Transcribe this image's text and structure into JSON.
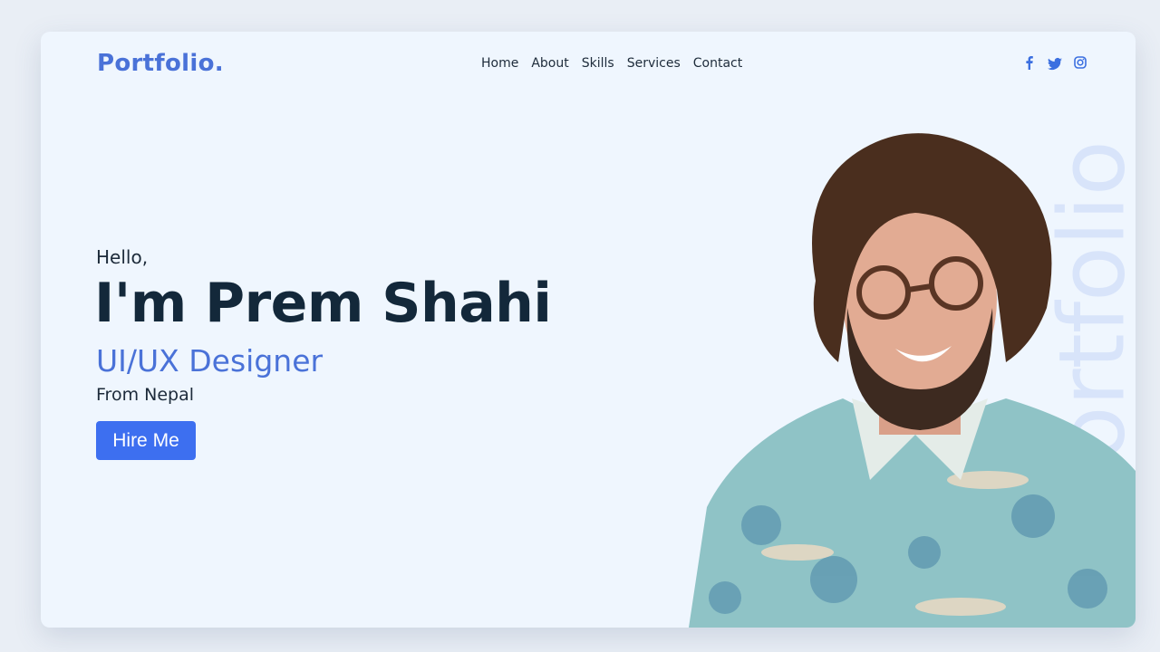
{
  "brand": {
    "logo": "Portfolio.",
    "accent": "#4a72d8",
    "button_color": "#3d6ff0"
  },
  "nav": {
    "items": [
      "Home",
      "About",
      "Skills",
      "Services",
      "Contact"
    ]
  },
  "social": [
    "facebook-icon",
    "twitter-icon",
    "instagram-icon"
  ],
  "hero": {
    "greeting": "Hello,",
    "name": "I'm Prem Shahi",
    "role": "UI/UX Designer",
    "location": "From Nepal",
    "cta": "Hire Me",
    "watermark": "Portfolio"
  }
}
